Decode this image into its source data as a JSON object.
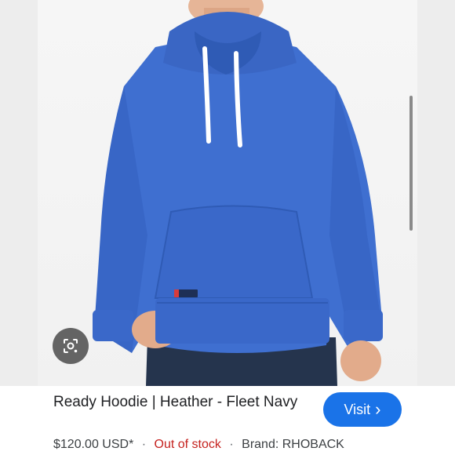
{
  "product": {
    "title": "Ready Hoodie | Heather - Fleet Navy",
    "price": "$120.00 USD*",
    "stock_status": "Out of stock",
    "brand": "Brand: RHOBACK",
    "separator": "·"
  },
  "actions": {
    "visit_label": "Visit",
    "visit_chevron": "›"
  },
  "image": {
    "description_icon": "lens-search-icon",
    "garment_tag": "RHOBACK"
  },
  "colors": {
    "accent": "#1a73e8",
    "out_of_stock": "#c5221f",
    "hoodie": "#3f6fd0"
  }
}
